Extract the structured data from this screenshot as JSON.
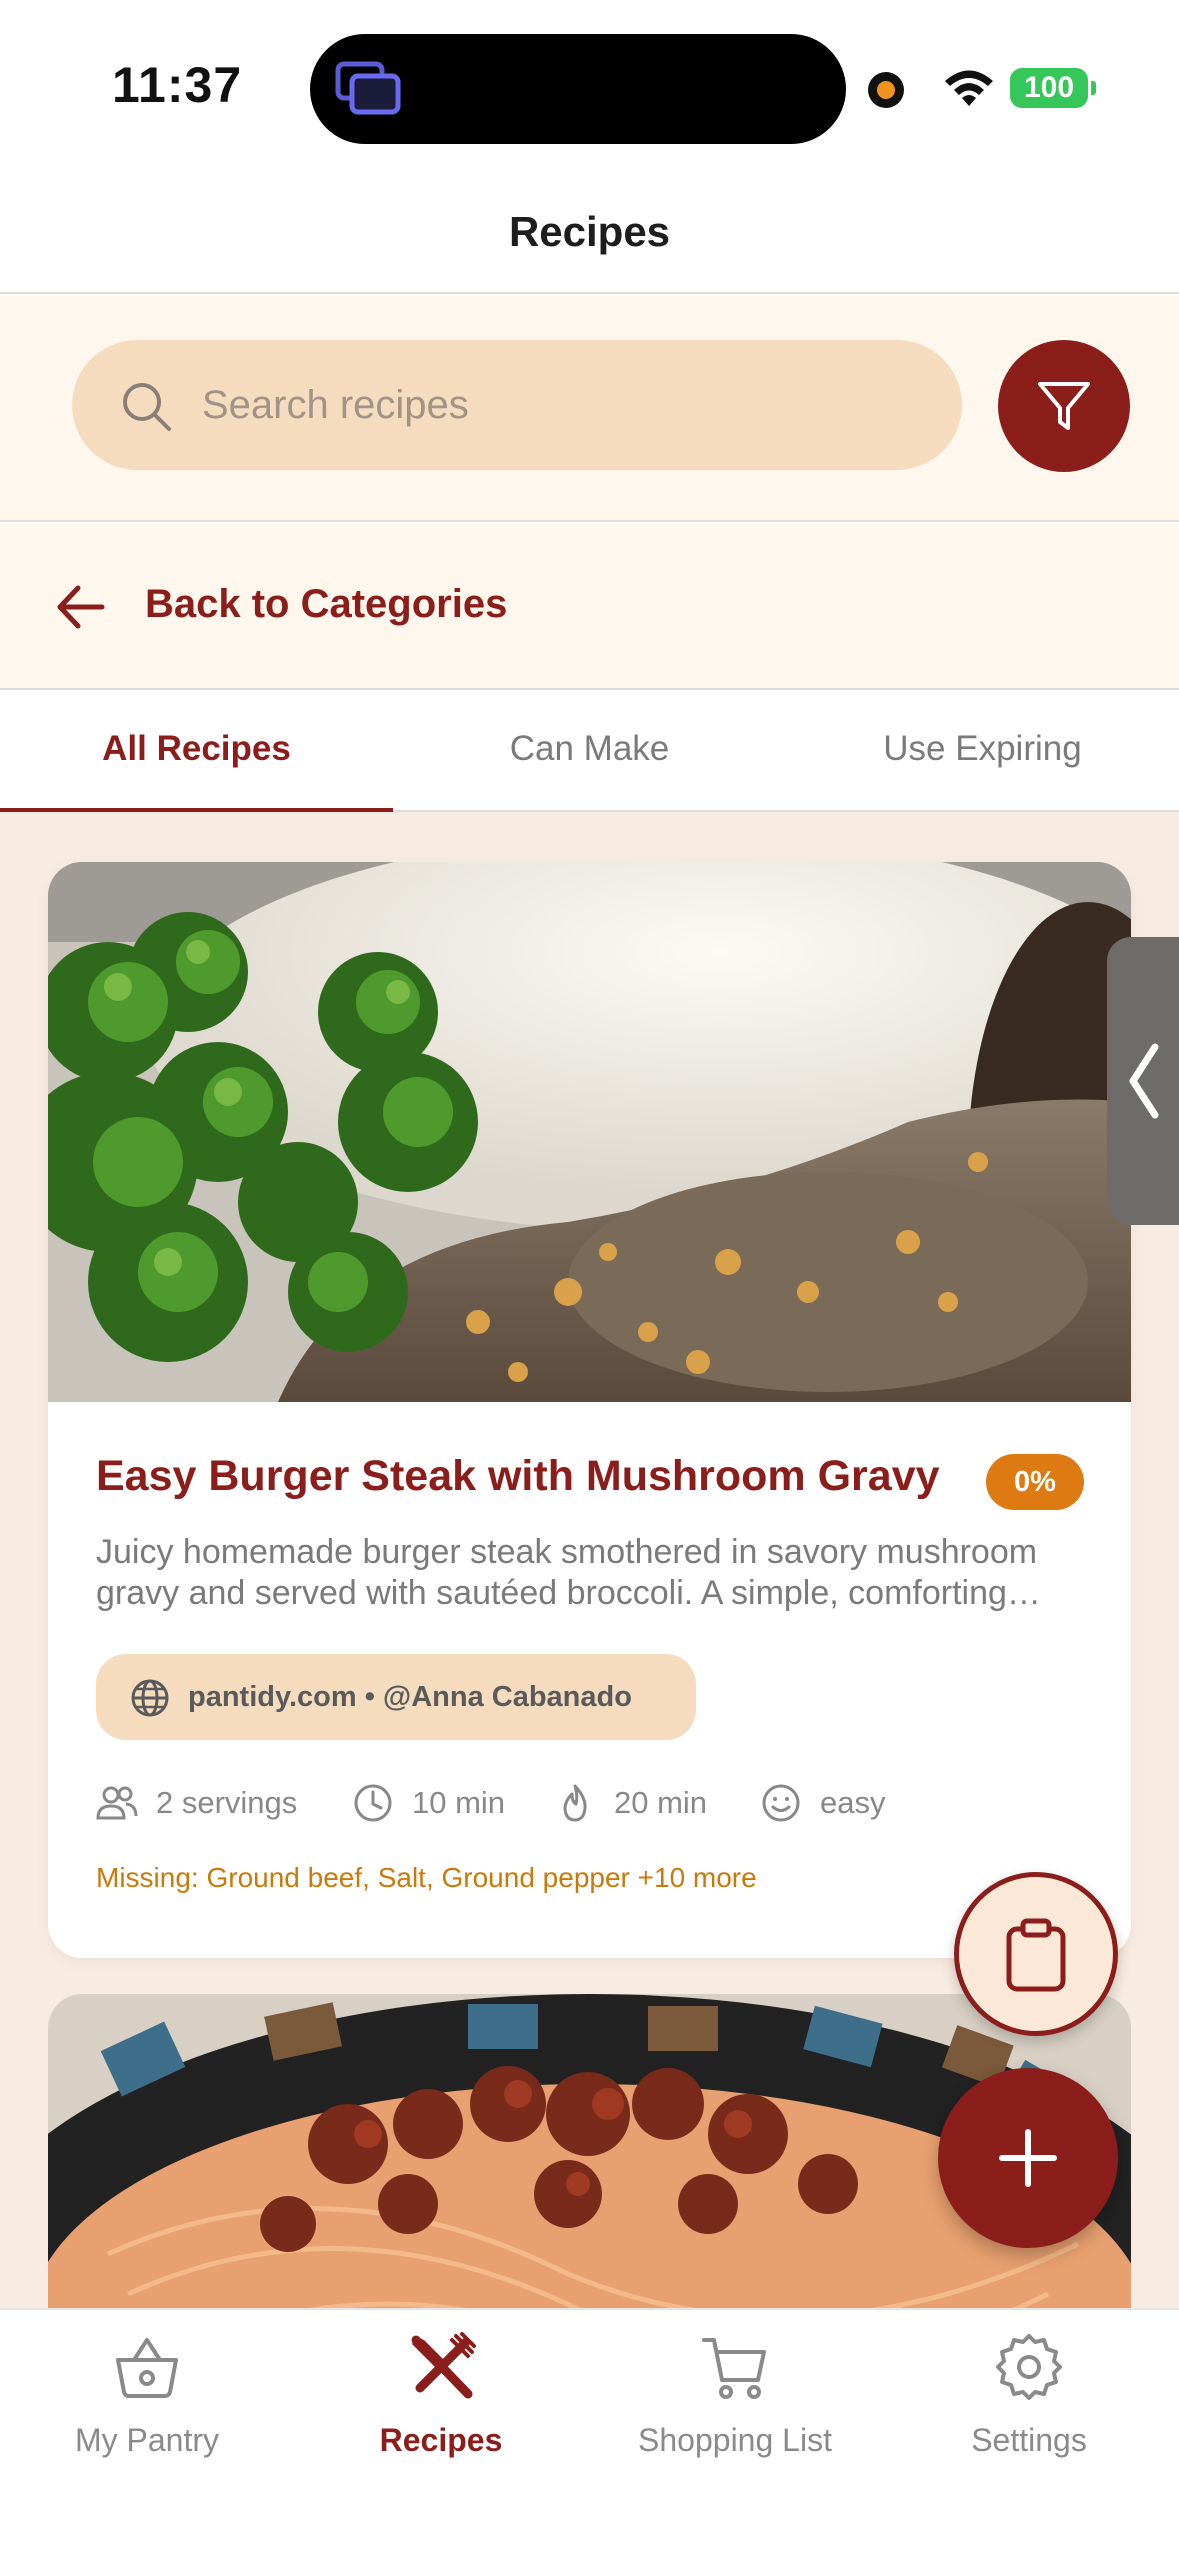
{
  "status_bar": {
    "time": "11:37",
    "battery": "100"
  },
  "nav": {
    "title": "Recipes"
  },
  "search": {
    "placeholder": "Search recipes"
  },
  "back": {
    "label": "Back to Categories"
  },
  "tabs": [
    {
      "label": "All Recipes",
      "active": true
    },
    {
      "label": "Can Make",
      "active": false
    },
    {
      "label": "Use Expiring",
      "active": false
    }
  ],
  "recipes": [
    {
      "title": "Easy Burger Steak with Mushroom Gravy",
      "match": "0%",
      "description": "Juicy homemade burger steak smothered in savory mushroom gravy and served with sautéed broccoli. A simple, comforting meal ready in minutes.",
      "source": "pantidy.com • @Anna Cabanado",
      "servings": "2 servings",
      "prep_time": "10 min",
      "cook_time": "20 min",
      "difficulty": "easy",
      "missing": "Missing: Ground beef, Salt, Ground pepper +10 more"
    }
  ],
  "tab_bar": [
    {
      "label": "My Pantry",
      "icon": "basket-icon",
      "active": false
    },
    {
      "label": "Recipes",
      "icon": "utensils-icon",
      "active": true
    },
    {
      "label": "Shopping List",
      "icon": "cart-icon",
      "active": false
    },
    {
      "label": "Settings",
      "icon": "gear-icon",
      "active": false
    }
  ],
  "colors": {
    "accent": "#8b1e1a",
    "badge": "#dd7a11",
    "missing": "#c97a0b",
    "pill": "#f5dcbf"
  }
}
